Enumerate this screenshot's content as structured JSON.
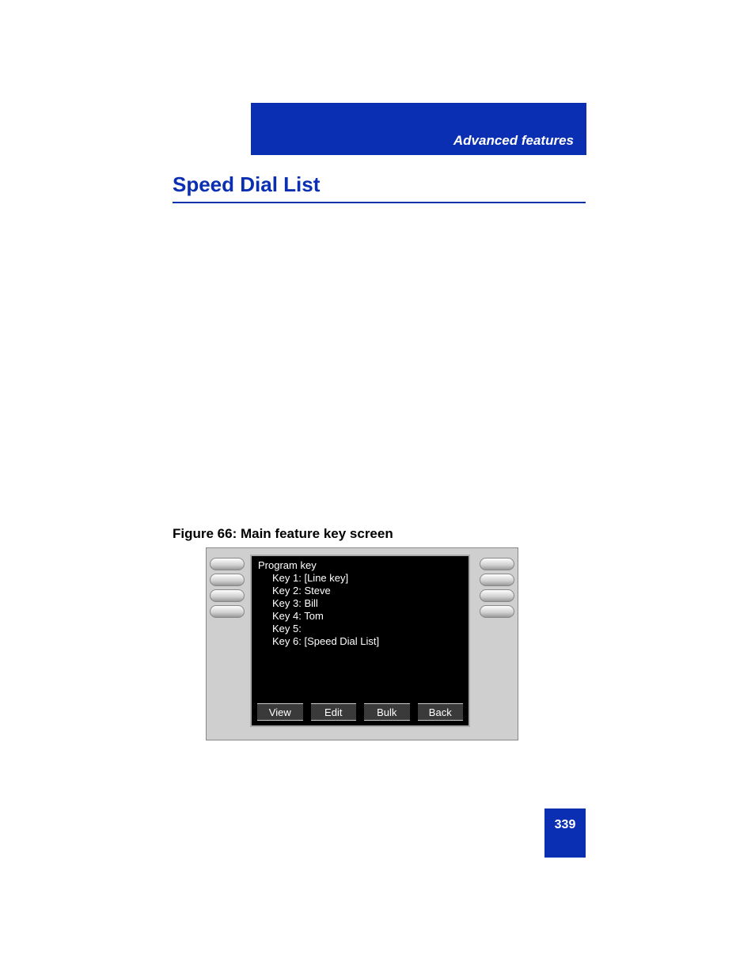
{
  "header": {
    "section_label": "Advanced features"
  },
  "title": "Speed Dial List",
  "figure": {
    "caption": "Figure 66: Main feature key screen",
    "screen": {
      "header": "Program key",
      "keys": [
        "Key 1: [Line key]",
        "Key 2: Steve",
        "Key 3: Bill",
        "Key 4: Tom",
        "Key 5:",
        "Key 6: [Speed Dial List]"
      ],
      "softkeys": [
        "View",
        "Edit",
        "Bulk",
        "Back"
      ]
    }
  },
  "page_number": "339"
}
